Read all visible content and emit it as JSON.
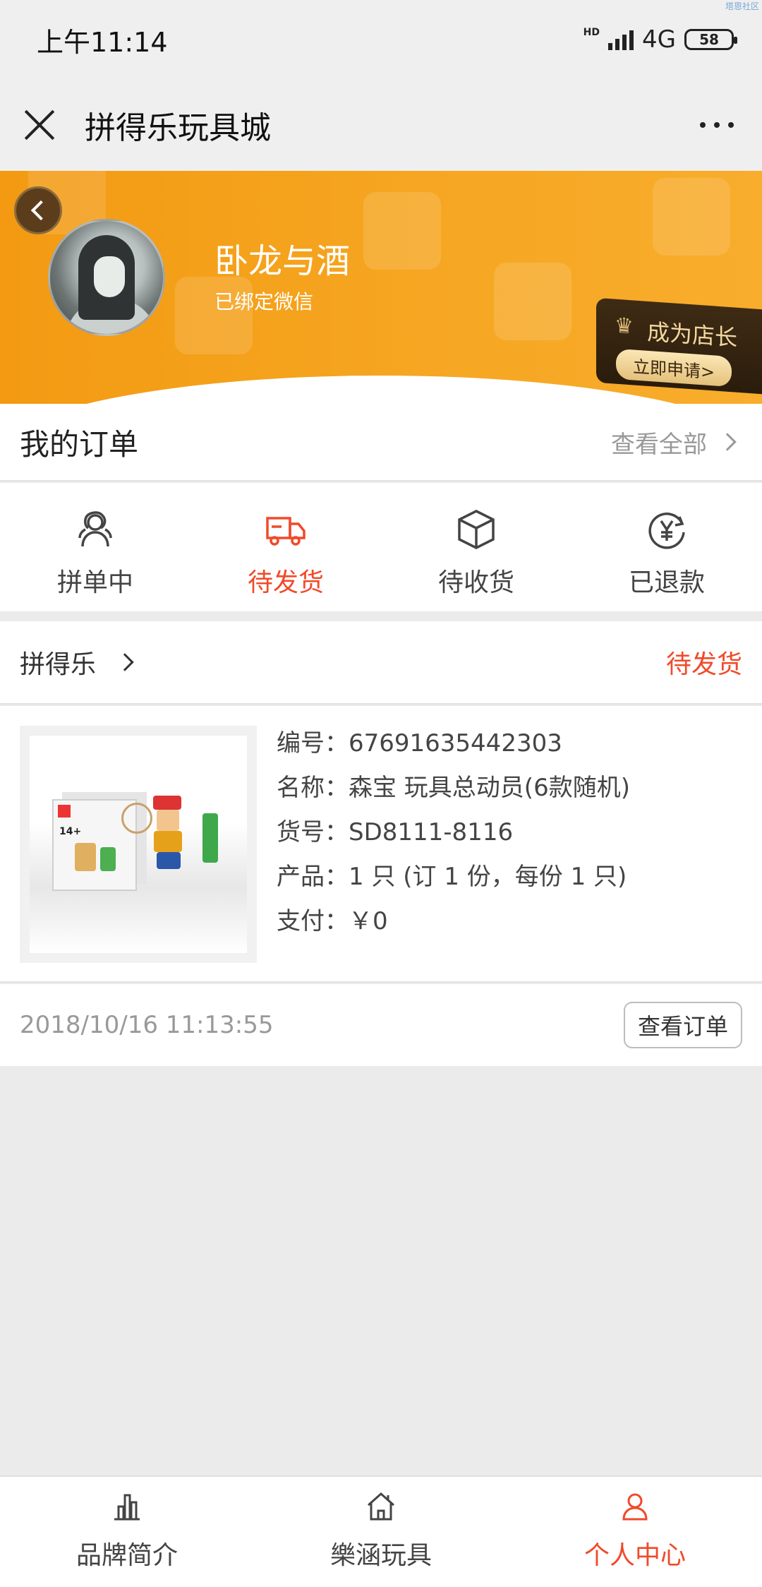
{
  "status_bar": {
    "time": "上午11:14",
    "network": "4G",
    "hd": "HD",
    "battery": "58",
    "corner_text": "塔恩社区"
  },
  "nav": {
    "title": "拼得乐玩具城"
  },
  "profile": {
    "username": "卧龙与酒",
    "bound_label": "已绑定微信",
    "shop_owner_title": "成为店长",
    "shop_owner_cta": "立即申请>"
  },
  "orders": {
    "title": "我的订单",
    "view_all": "查看全部",
    "tabs": [
      {
        "label": "拼单中",
        "icon": "group-icon"
      },
      {
        "label": "待发货",
        "icon": "truck-icon",
        "active": true
      },
      {
        "label": "待收货",
        "icon": "box-icon"
      },
      {
        "label": "已退款",
        "icon": "refund-icon"
      }
    ]
  },
  "order": {
    "shop": "拼得乐",
    "status": "待发货",
    "number_line": "编号：67691635442303",
    "name_line": "名称：森宝 玩具总动员(6款随机)",
    "sku_line": "货号：SD8111-8116",
    "product_line": "产品：1 只 (订 1 份，每份 1 只)",
    "pay_line": "支付：￥0",
    "time": "2018/10/16 11:13:55",
    "view_button": "查看订单"
  },
  "bottom_nav": [
    {
      "label": "品牌简介",
      "icon": "chart-icon"
    },
    {
      "label": "樂涵玩具",
      "icon": "home-icon"
    },
    {
      "label": "个人中心",
      "icon": "user-icon",
      "active": true
    }
  ],
  "colors": {
    "accent": "#f04a2a",
    "banner": "#f39a12"
  }
}
